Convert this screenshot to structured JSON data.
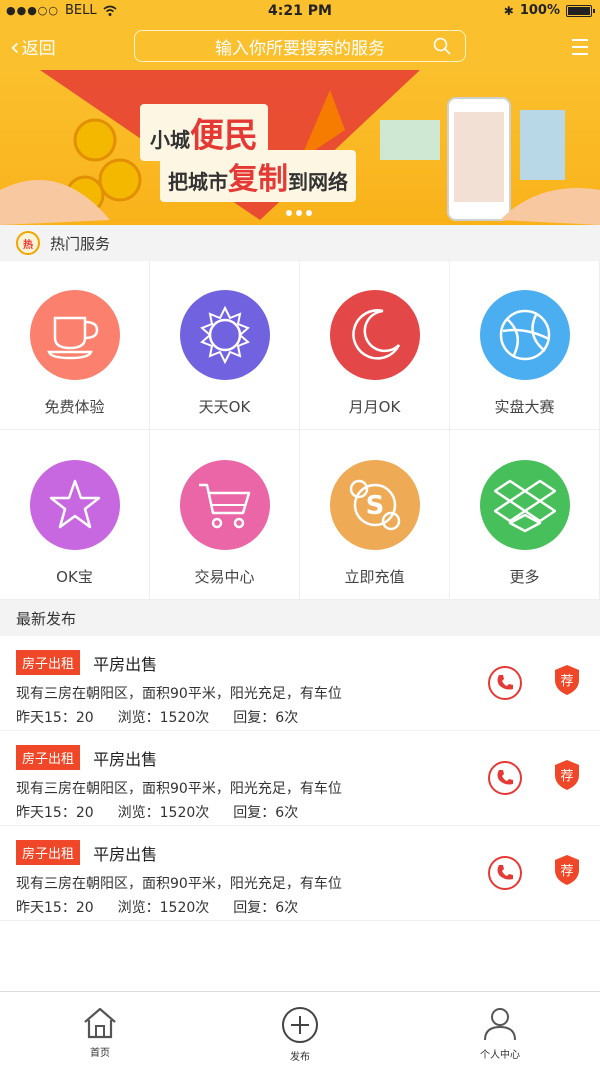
{
  "status": {
    "carrier": "BELL",
    "time": "4:21 PM",
    "battery": "100%"
  },
  "header": {
    "back_label": "返回",
    "search_placeholder": "输入你所要搜索的服务"
  },
  "banner": {
    "line1_small": "小城",
    "line1_big": "便民",
    "line2_a": "把城市",
    "line2_big": "复制",
    "line2_b": "到网络",
    "slide_count": 3
  },
  "hot_section": {
    "badge": "热",
    "title": "热门服务"
  },
  "services": [
    {
      "label": "免费体验",
      "icon": "coffee-cup-icon",
      "color": "#fb806d"
    },
    {
      "label": "天天OK",
      "icon": "sun-icon",
      "color": "#7162e0"
    },
    {
      "label": "月月OK",
      "icon": "moon-icon",
      "color": "#e44747"
    },
    {
      "label": "实盘大赛",
      "icon": "basketball-icon",
      "color": "#4aaef0"
    },
    {
      "label": "OK宝",
      "icon": "star-icon",
      "color": "#c868e0"
    },
    {
      "label": "交易中心",
      "icon": "cart-icon",
      "color": "#ea66a6"
    },
    {
      "label": "立即充值",
      "icon": "skype-icon",
      "color": "#eeaa55"
    },
    {
      "label": "更多",
      "icon": "dropbox-icon",
      "color": "#47bf5b"
    }
  ],
  "latest_section": {
    "title": "最新发布"
  },
  "posts": [
    {
      "tag": "房子出租",
      "title": "平房出售",
      "desc": "现有三房在朝阳区，面积90平米，阳光充足，有车位",
      "time": "昨天15：20",
      "views": "浏览：1520次",
      "replies": "回复：6次",
      "save_label": "荐"
    },
    {
      "tag": "房子出租",
      "title": "平房出售",
      "desc": "现有三房在朝阳区，面积90平米，阳光充足，有车位",
      "time": "昨天15：20",
      "views": "浏览：1520次",
      "replies": "回复：6次",
      "save_label": "荐"
    },
    {
      "tag": "房子出租",
      "title": "平房出售",
      "desc": "现有三房在朝阳区，面积90平米，阳光充足，有车位",
      "time": "昨天15：20",
      "views": "浏览：1520次",
      "replies": "回复：6次",
      "save_label": "荐"
    }
  ],
  "tabbar": [
    {
      "label": "首页",
      "icon": "home-icon"
    },
    {
      "label": "发布",
      "icon": "plus-circle-icon"
    },
    {
      "label": "个人中心",
      "icon": "user-icon"
    }
  ],
  "colors": {
    "accent": "#fbc02d",
    "tag": "#ef4727",
    "phone": "#e53935"
  }
}
